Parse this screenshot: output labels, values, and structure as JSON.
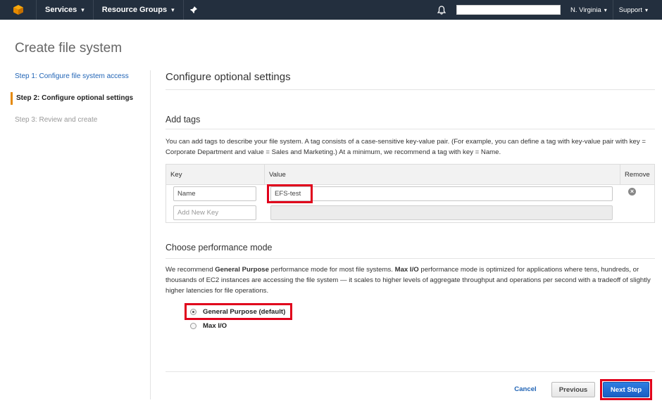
{
  "nav": {
    "services": "Services",
    "resource_groups": "Resource Groups",
    "region": "N. Virginia",
    "support": "Support",
    "caret": "▾",
    "search_value": ""
  },
  "page_title": "Create file system",
  "steps": [
    {
      "label": "Step 1: Configure file system access",
      "state": "link"
    },
    {
      "label": "Step 2: Configure optional settings",
      "state": "active"
    },
    {
      "label": "Step 3: Review and create",
      "state": "disabled"
    }
  ],
  "section_title": "Configure optional settings",
  "tags": {
    "title": "Add tags",
    "description": "You can add tags to describe your file system. A tag consists of a case-sensitive key-value pair. (For example, you can define a tag with key-value pair with key = Corporate Department and value = Sales and Marketing.) At a minimum, we recommend a tag with key = Name.",
    "columns": {
      "key": "Key",
      "value": "Value",
      "remove": "Remove"
    },
    "rows": [
      {
        "key": "Name",
        "value": "EFS-test"
      }
    ],
    "new_key_placeholder": "Add New Key"
  },
  "performance": {
    "title": "Choose performance mode",
    "desc_1": "We recommend ",
    "desc_b1": "General Purpose",
    "desc_2": " performance mode for most file systems. ",
    "desc_b2": "Max I/O",
    "desc_3": " performance mode is optimized for applications where tens, hundreds, or thousands of EC2 instances are accessing the file system — it scales to higher levels of aggregate throughput and operations per second with a tradeoff of slightly higher latencies for file operations.",
    "options": [
      {
        "label": "General Purpose (default)",
        "checked": true
      },
      {
        "label": "Max I/O",
        "checked": false
      }
    ]
  },
  "footer": {
    "cancel": "Cancel",
    "previous": "Previous",
    "next": "Next Step"
  },
  "colors": {
    "nav_bg": "#232f3e",
    "link": "#1f63b5",
    "highlight": "#e0001b",
    "active_step_bar": "#e5890a",
    "primary_button": "#1a5fc4"
  }
}
